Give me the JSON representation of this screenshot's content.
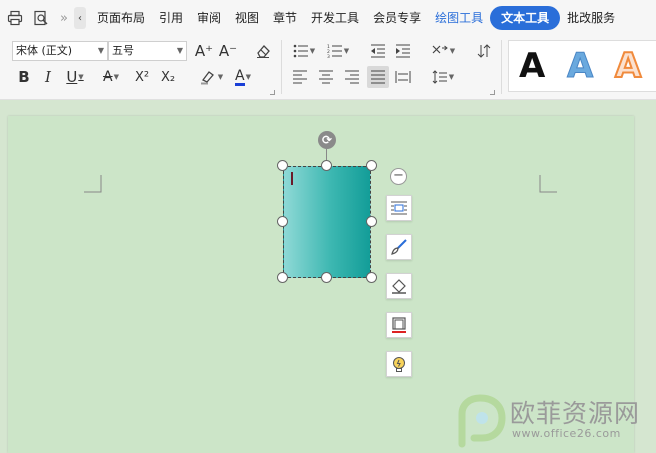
{
  "colors": {
    "accent": "#2a6ed9",
    "page_bg": "#cce5c8",
    "shape_gradient_start": "#8fd9d6",
    "shape_gradient_end": "#139d98",
    "font_color_underline": "#1a3fd6"
  },
  "tabs": {
    "prev_tab_arrow": "‹",
    "items": [
      {
        "label": "页面布局"
      },
      {
        "label": "引用"
      },
      {
        "label": "审阅"
      },
      {
        "label": "视图"
      },
      {
        "label": "章节"
      },
      {
        "label": "开发工具"
      },
      {
        "label": "会员专享"
      },
      {
        "label": "绘图工具"
      },
      {
        "label": "文本工具"
      },
      {
        "label": "批改服务"
      }
    ]
  },
  "toolbar": {
    "font_name": "宋体 (正文)",
    "font_size": "五号",
    "bold": "B",
    "italic": "I",
    "underline": "U",
    "superscript": "X²",
    "subscript": "X₂",
    "font_color": "A",
    "grow_font": "A⁺",
    "shrink_font": "A⁻"
  },
  "wordart_gallery": [
    "A",
    "A",
    "A"
  ],
  "watermark": {
    "name": "欧菲资源网",
    "url": "www.office26.com"
  }
}
